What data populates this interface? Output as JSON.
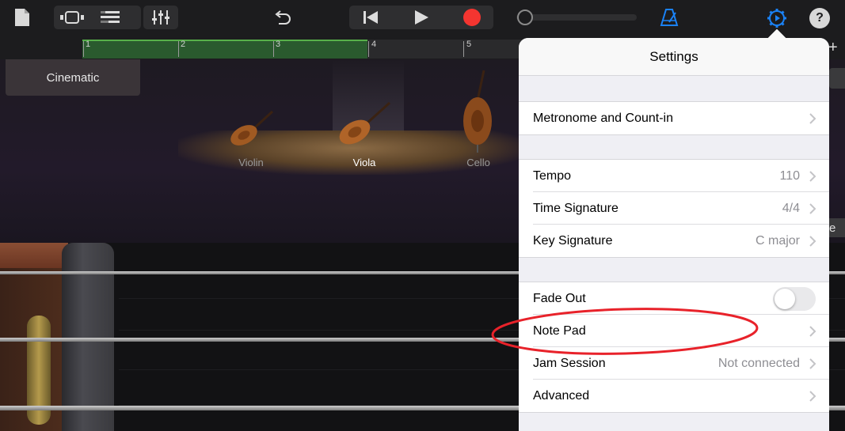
{
  "toolbar": {
    "icons": [
      "document-icon",
      "tracks-view-icon",
      "track-list-icon",
      "mixer-icon",
      "undo-icon",
      "rewind-icon",
      "play-icon",
      "record-icon",
      "master-volume-slider",
      "metronome-icon",
      "settings-icon",
      "help-icon"
    ],
    "help_label": "?"
  },
  "ruler": {
    "bars": [
      "1",
      "2",
      "3",
      "4",
      "5"
    ],
    "add_label": "+"
  },
  "stage": {
    "preset_label": "Cinematic",
    "instruments": [
      {
        "label": "Violin",
        "selected": false
      },
      {
        "label": "Viola",
        "selected": true
      },
      {
        "label": "Cello",
        "selected": false
      }
    ]
  },
  "peek": {
    "right_letter": "e"
  },
  "settings": {
    "title": "Settings",
    "rows": {
      "metronome": {
        "label": "Metronome and Count-in"
      },
      "tempo": {
        "label": "Tempo",
        "value": "110"
      },
      "time_signature": {
        "label": "Time Signature",
        "value": "4/4"
      },
      "key_signature": {
        "label": "Key Signature",
        "value": "C major"
      },
      "fade_out": {
        "label": "Fade Out",
        "on": false
      },
      "note_pad": {
        "label": "Note Pad"
      },
      "jam_session": {
        "label": "Jam Session",
        "value": "Not connected"
      },
      "advanced": {
        "label": "Advanced"
      }
    }
  },
  "colors": {
    "accent_blue": "#1a82f7",
    "record_red": "#f43530",
    "annotation_red": "#e8222a"
  }
}
